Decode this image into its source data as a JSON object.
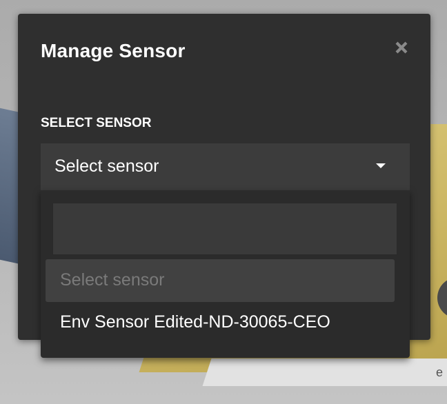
{
  "modal": {
    "title": "Manage Sensor",
    "close_icon": "close-icon",
    "field_label": "SELECT SENSOR"
  },
  "select": {
    "selected_text": "Select sensor",
    "caret_icon": "caret-down-icon"
  },
  "dropdown": {
    "search_value": "",
    "options": [
      {
        "label": "Select sensor",
        "state": "placeholder"
      },
      {
        "label": "Env Sensor Edited-ND-30065-CEO",
        "state": "normal"
      }
    ]
  },
  "colors": {
    "modal_bg": "#2f2f2f",
    "select_bg": "#3c3c3c",
    "dropdown_bg": "#2b2b2b",
    "text": "#ffffff",
    "placeholder_text": "#7a7a7a"
  }
}
